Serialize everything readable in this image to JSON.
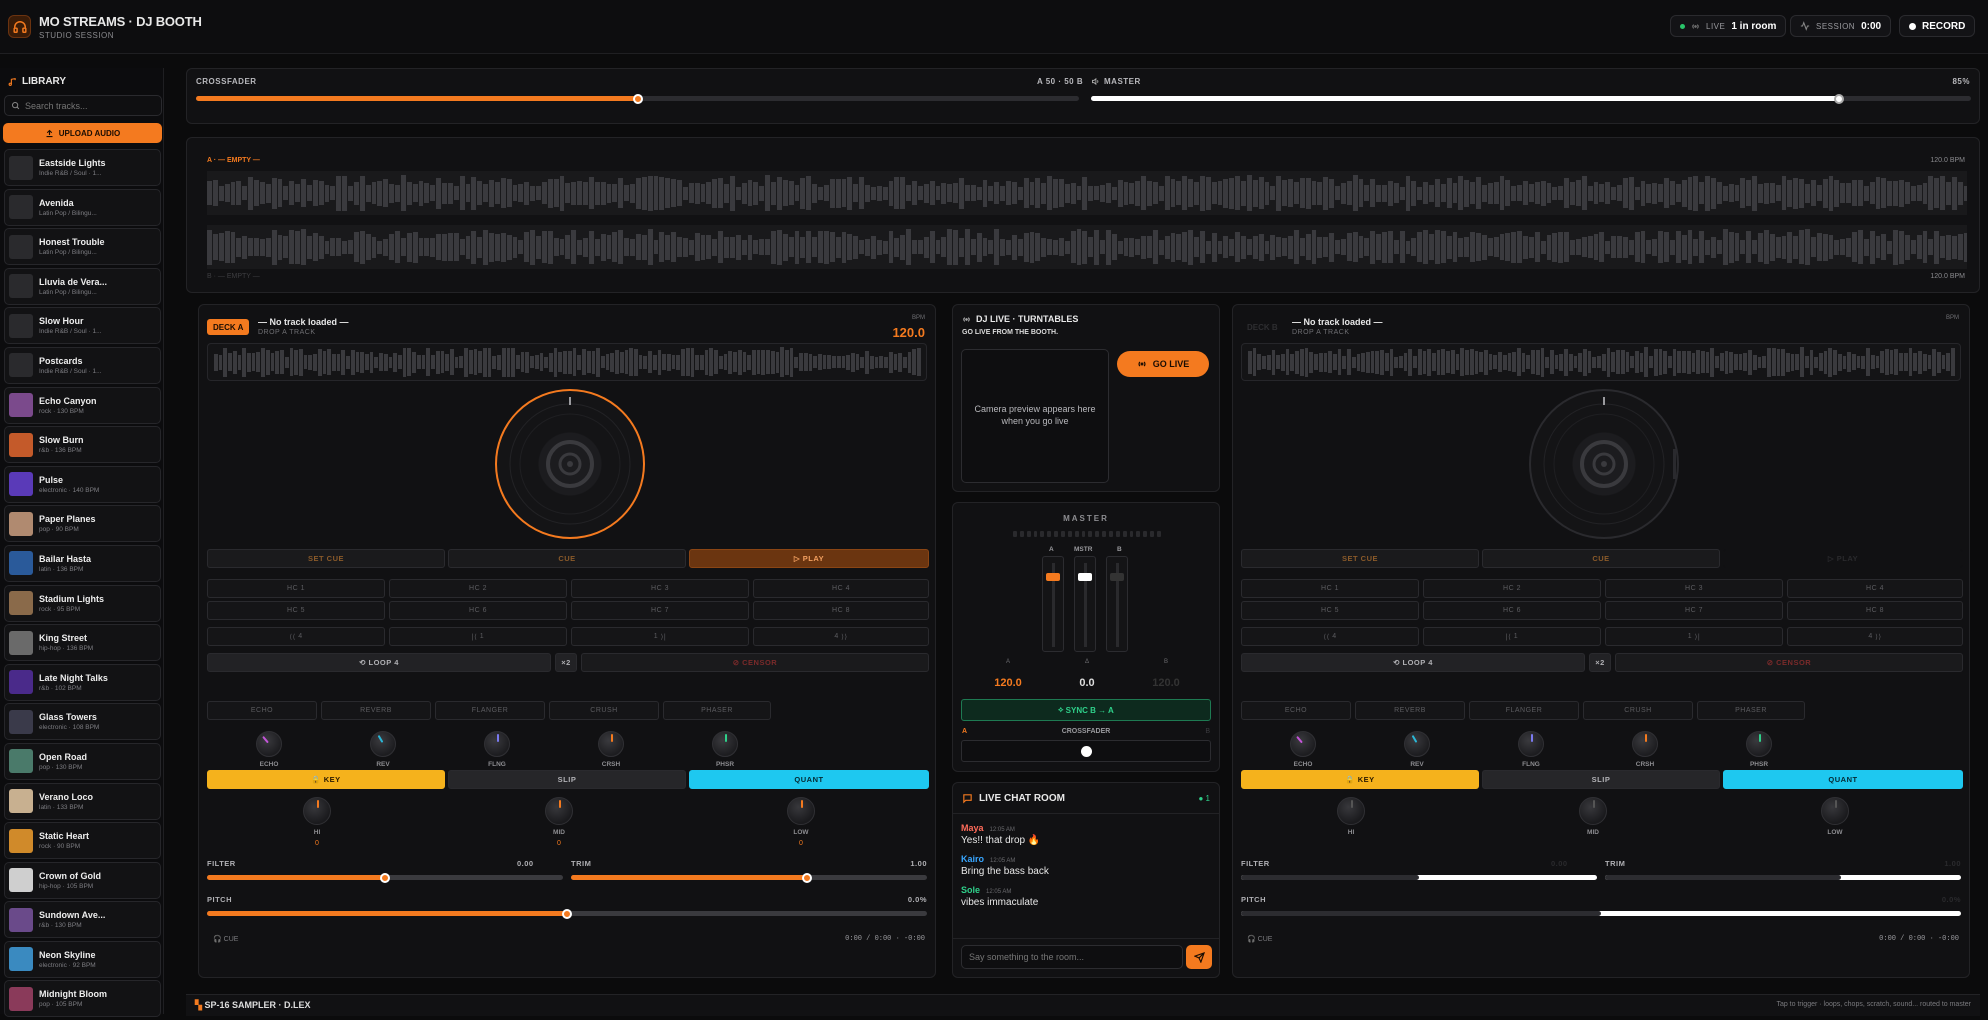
{
  "header": {
    "title": "MO STREAMS · DJ BOOTH",
    "subtitle": "STUDIO SESSION",
    "live_label": "LIVE",
    "room_count": "1 in room",
    "session_label": "SESSION",
    "session_time": "0:00",
    "record_label": "RECORD"
  },
  "library": {
    "title": "LIBRARY",
    "search_placeholder": "Search tracks...",
    "upload_label": "UPLOAD AUDIO",
    "tracks": [
      {
        "title": "Eastside Lights",
        "sub": "Indie R&B / Soul · 1..."
      },
      {
        "title": "Avenida",
        "sub": "Latin Pop / Bilingu..."
      },
      {
        "title": "Honest Trouble",
        "sub": "Latin Pop / Bilingu..."
      },
      {
        "title": "Lluvia de Vera...",
        "sub": "Latin Pop / Bilingu..."
      },
      {
        "title": "Slow Hour",
        "sub": "Indie R&B / Soul · 1..."
      },
      {
        "title": "Postcards",
        "sub": "Indie R&B / Soul · 1..."
      },
      {
        "title": "Echo Canyon",
        "sub": "rock · 130 BPM"
      },
      {
        "title": "Slow Burn",
        "sub": "r&b · 136 BPM"
      },
      {
        "title": "Pulse",
        "sub": "electronic · 140 BPM"
      },
      {
        "title": "Paper Planes",
        "sub": "pop · 90 BPM"
      },
      {
        "title": "Bailar Hasta",
        "sub": "latin · 136 BPM"
      },
      {
        "title": "Stadium Lights",
        "sub": "rock · 95 BPM"
      },
      {
        "title": "King Street",
        "sub": "hip-hop · 136 BPM"
      },
      {
        "title": "Late Night Talks",
        "sub": "r&b · 102 BPM"
      },
      {
        "title": "Glass Towers",
        "sub": "electronic · 108 BPM"
      },
      {
        "title": "Open Road",
        "sub": "pop · 130 BPM"
      },
      {
        "title": "Verano Loco",
        "sub": "latin · 133 BPM"
      },
      {
        "title": "Static Heart",
        "sub": "rock · 90 BPM"
      },
      {
        "title": "Crown of Gold",
        "sub": "hip-hop · 105 BPM"
      },
      {
        "title": "Sundown Ave...",
        "sub": "r&b · 130 BPM"
      },
      {
        "title": "Neon Skyline",
        "sub": "electronic · 92 BPM"
      },
      {
        "title": "Midnight Bloom",
        "sub": "pop · 105 BPM"
      }
    ]
  },
  "thumb_colors": [
    "#2a2a2d",
    "#2a2a2d",
    "#2a2a2d",
    "#2a2a2d",
    "#2a2a2d",
    "#2a2a2d",
    "#7b4a8c",
    "#c45a2a",
    "#5a3ab8",
    "#b08a70",
    "#2a5a9a",
    "#8a6a4a",
    "#6a6a6a",
    "#4a2a8a",
    "#3a3a4a",
    "#4a7a6a",
    "#c8b090",
    "#d08a2a",
    "#cfcfcf",
    "#6a4a8a",
    "#3a8ac0",
    "#8a3a5a"
  ],
  "crossfader": {
    "label": "CROSSFADER",
    "value_text": "A 50 · 50 B",
    "position": 0.5,
    "master_label": "MASTER",
    "master_value": "85%",
    "master_level": 0.85
  },
  "overview": {
    "top_label": "A · — EMPTY —",
    "top_bpm": "120.0 BPM",
    "bottom_label": "B · — EMPTY —",
    "bottom_bpm": "120.0 BPM"
  },
  "deck_a": {
    "badge": "DECK A",
    "title": "— No track loaded —",
    "sub": "DROP A TRACK",
    "bpm_label": "BPM",
    "bpm": "120.0",
    "set_cue": "SET CUE",
    "cue": "CUE",
    "play": "PLAY",
    "hot_cues": [
      "HC 1",
      "HC 2",
      "HC 3",
      "HC 4",
      "HC 5",
      "HC 6",
      "HC 7",
      "HC 8"
    ],
    "beat_jumps": [
      "4",
      "1",
      "1",
      "4"
    ],
    "loop": "LOOP 4",
    "loop_mult": "×2",
    "censor": "CENSOR",
    "fx": [
      "ECHO",
      "REVERB",
      "FLANGER",
      "CRUSH",
      "PHASER"
    ],
    "fx_knob_labels": [
      "ECHO",
      "REV",
      "FLNG",
      "CRSH",
      "PHSR"
    ],
    "fx_values": [
      "+45",
      "+40",
      "+50",
      "+50",
      "+50"
    ],
    "key": "KEY",
    "slip": "SLIP",
    "quant": "QUANT",
    "eq_labels": [
      "HI",
      "MID",
      "LOW"
    ],
    "eq_values": [
      "0",
      "0",
      "0"
    ],
    "filter_label": "FILTER",
    "filter_value": "0.00",
    "trim_label": "TRIM",
    "trim_value": "1.00",
    "pitch_label": "PITCH",
    "pitch_value": "0.0%",
    "cue_label": "CUE",
    "time": "0:00 / 0:00 · -0:00"
  },
  "deck_b": {
    "badge": "DECK B",
    "title": "— No track loaded —",
    "sub": "DROP A TRACK",
    "bpm_label": "BPM",
    "set_cue": "SET CUE",
    "cue": "CUE",
    "play": "PLAY",
    "loop": "LOOP 4",
    "loop_mult": "×2",
    "censor": "CENSOR",
    "key": "KEY",
    "slip": "SLIP",
    "quant": "QUANT",
    "filter_label": "FILTER",
    "filter_value": "0.00",
    "trim_label": "TRIM",
    "trim_value": "1.00",
    "pitch_label": "PITCH",
    "pitch_value": "0.0%",
    "cue_label": "CUE",
    "time": "0:00 / 0:00 · -0:00"
  },
  "live": {
    "title": "DJ LIVE · TURNTABLES",
    "subtitle": "GO LIVE FROM THE BOOTH.",
    "camera_text": "Camera preview appears here when you go live",
    "go_live": "GO LIVE"
  },
  "master": {
    "title": "MASTER",
    "ch_a": "A",
    "ch_mstr": "MSTR",
    "ch_b": "B",
    "a_label": "A",
    "delta_label": "Δ",
    "b_label": "B",
    "bpm_a": "120.0",
    "delta": "0.0",
    "bpm_b": "120.0",
    "sync": "SYNC B → A",
    "xf_a": "A",
    "xf_label": "CROSSFADER",
    "xf_b": "B"
  },
  "chat": {
    "title": "LIVE CHAT ROOM",
    "count": "● 1",
    "messages": [
      {
        "user": "Maya",
        "time": "12:05 AM",
        "text": "Yes!! that drop 🔥",
        "color": "#ff6b5a"
      },
      {
        "user": "Kairo",
        "time": "12:05 AM",
        "text": "Bring the bass back",
        "color": "#38a6ff"
      },
      {
        "user": "Sole",
        "time": "12:05 AM",
        "text": "vibes immaculate",
        "color": "#2fd08a"
      }
    ],
    "placeholder": "Say something to the room..."
  },
  "sampler": {
    "title": "SP-16 SAMPLER · D.LEX",
    "hint": "Tap to trigger · loops, chops, scratch, sound... routed to master"
  }
}
